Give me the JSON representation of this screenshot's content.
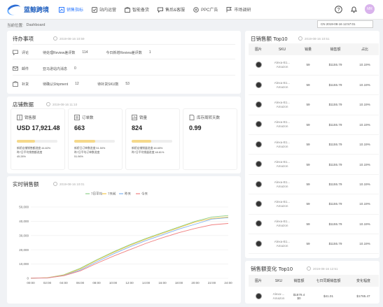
{
  "app": {
    "title": "蓝鲸跨境"
  },
  "nav": [
    {
      "label": "销售指标",
      "icon": "chart-icon",
      "active": true
    },
    {
      "label": "站内运营",
      "icon": "check-icon"
    },
    {
      "label": "智能备货",
      "icon": "box-icon"
    },
    {
      "label": "售后&客服",
      "icon": "chat-icon"
    },
    {
      "label": "PPC广告",
      "icon": "ad-icon"
    },
    {
      "label": "市场调研",
      "icon": "flag-icon"
    }
  ],
  "header": {
    "avatar": "MR"
  },
  "breadcrumb": {
    "prefix": "当前位置:",
    "page": "Dashboard"
  },
  "date_select": "CN 2019-08-16 12:57:01",
  "todo": {
    "title": "待办事项",
    "time": "2019-08-16 10:59",
    "rows": [
      {
        "label": "评论",
        "a_label": "待处理Review差评数",
        "a_val": "114",
        "b_label": "今日新增Review差评数",
        "b_val": "1"
      },
      {
        "label": "邮件",
        "a_label": "亚马逊站内消息",
        "a_val": "0"
      },
      {
        "label": "补货",
        "a_label": "待确认Shipment",
        "a_val": "12",
        "b_label": "待补货SKU数",
        "b_val": "53"
      }
    ]
  },
  "shop": {
    "title": "店铺数据",
    "time": "2019-08-16 11:10",
    "metrics": [
      {
        "label": "销售额",
        "value": "USD 17,921.48",
        "progress": 0.448,
        "l1": "新桥店铺销售额进度 44.82%",
        "l2": "昨7日平均销售额进度",
        "l3": "45.28%"
      },
      {
        "label": "订单数",
        "value": "663",
        "progress": 0.5151,
        "l1": "新桥日订单数进度 51.50%",
        "l2": "昨7日平均订单数进度",
        "l3": "51.96%"
      },
      {
        "label": "销量",
        "value": "824",
        "progress": 0.4866,
        "l1": "新桥店铺销量进度 48.65%",
        "l2": "昨7日平均销量进度 48.81%",
        "l3": ""
      },
      {
        "label": "库存周转天数",
        "value": "0.99",
        "progress": null,
        "l1": "",
        "l2": "",
        "l3": ""
      }
    ]
  },
  "realtime": {
    "title": "实时销售额",
    "time": "2019-08-16 10:01"
  },
  "chart_data": {
    "type": "line",
    "x": [
      "00:00",
      "02:00",
      "04:00",
      "06:00",
      "08:00",
      "10:00",
      "12:00",
      "14:00",
      "16:00",
      "18:00",
      "20:00",
      "22:00",
      "24:00"
    ],
    "ylim": [
      0,
      50000
    ],
    "yticks": [
      "0",
      "10,000",
      "20,000",
      "30,000",
      "40,000",
      "50,000"
    ],
    "series": [
      {
        "name": "7日平均",
        "color": "#8fd08a",
        "values": [
          100,
          400,
          2500,
          7000,
          13000,
          18500,
          23500,
          28000,
          32000,
          36000,
          40000,
          43000,
          44000
        ]
      },
      {
        "name": "7天前",
        "color": "#f2c94c",
        "values": [
          100,
          450,
          2300,
          6500,
          12500,
          18000,
          23000,
          27500,
          31500,
          35500,
          39500,
          42000,
          43000
        ]
      },
      {
        "name": "昨天",
        "color": "#7fb2f0",
        "values": [
          100,
          350,
          2000,
          5800,
          11500,
          17000,
          22000,
          26500,
          30500,
          34500,
          38000,
          41500,
          42500
        ]
      },
      {
        "name": "今天",
        "color": "#f08080",
        "values": [
          100,
          300,
          1800,
          5200,
          10500,
          15500,
          20000,
          24500,
          28500,
          32000,
          35000,
          37500,
          38500
        ]
      }
    ]
  },
  "top10": {
    "title": "日销售额 Top10",
    "time": "2019-08-16 10:51",
    "headers": [
      "图片",
      "SKU",
      "销量",
      "销售额",
      "占比"
    ],
    "rows": [
      {
        "sku1": "Alexa-B1...",
        "sku2": "Amazon",
        "qty": "59",
        "amount": "$1155.79",
        "pct": "10.19%"
      },
      {
        "sku1": "Alexa-B1...",
        "sku2": "Amazon",
        "qty": "59",
        "amount": "$1155.79",
        "pct": "10.19%"
      },
      {
        "sku1": "Alexa-B1...",
        "sku2": "Amazon",
        "qty": "59",
        "amount": "$1155.79",
        "pct": "10.19%"
      },
      {
        "sku1": "Alexa-B1...",
        "sku2": "Amazon",
        "qty": "59",
        "amount": "$1155.79",
        "pct": "10.19%"
      },
      {
        "sku1": "Alexa-B1...",
        "sku2": "Amazon",
        "qty": "59",
        "amount": "$1155.79",
        "pct": "10.19%"
      },
      {
        "sku1": "Alexa-B1...",
        "sku2": "Amazon",
        "qty": "59",
        "amount": "$1155.79",
        "pct": "10.19%"
      },
      {
        "sku1": "Alexa-B1...",
        "sku2": "Amazon",
        "qty": "59",
        "amount": "$1155.79",
        "pct": "10.19%"
      },
      {
        "sku1": "Alexa-B1...",
        "sku2": "Amazon",
        "qty": "59",
        "amount": "$1155.79",
        "pct": "10.19%"
      },
      {
        "sku1": "Alexa-B1...",
        "sku2": "Amazon",
        "qty": "59",
        "amount": "$1155.79",
        "pct": "10.19%"
      },
      {
        "sku1": "Alexa-B1...",
        "sku2": "Amazon",
        "qty": "59",
        "amount": "$1155.79",
        "pct": "10.19%"
      }
    ]
  },
  "change10": {
    "title": "销售额变化 Top10",
    "time": "2019-08-16 12:51",
    "headers": [
      "图片",
      "SKU",
      "销售额",
      "七日同期销售额",
      "变化幅度"
    ],
    "row": {
      "sku1": "Alexa-...",
      "sku2": "Amazon",
      "amount": "$1879.4",
      "amount2": "$0",
      "prev": "$41.01",
      "chg": "$1765.47"
    }
  }
}
